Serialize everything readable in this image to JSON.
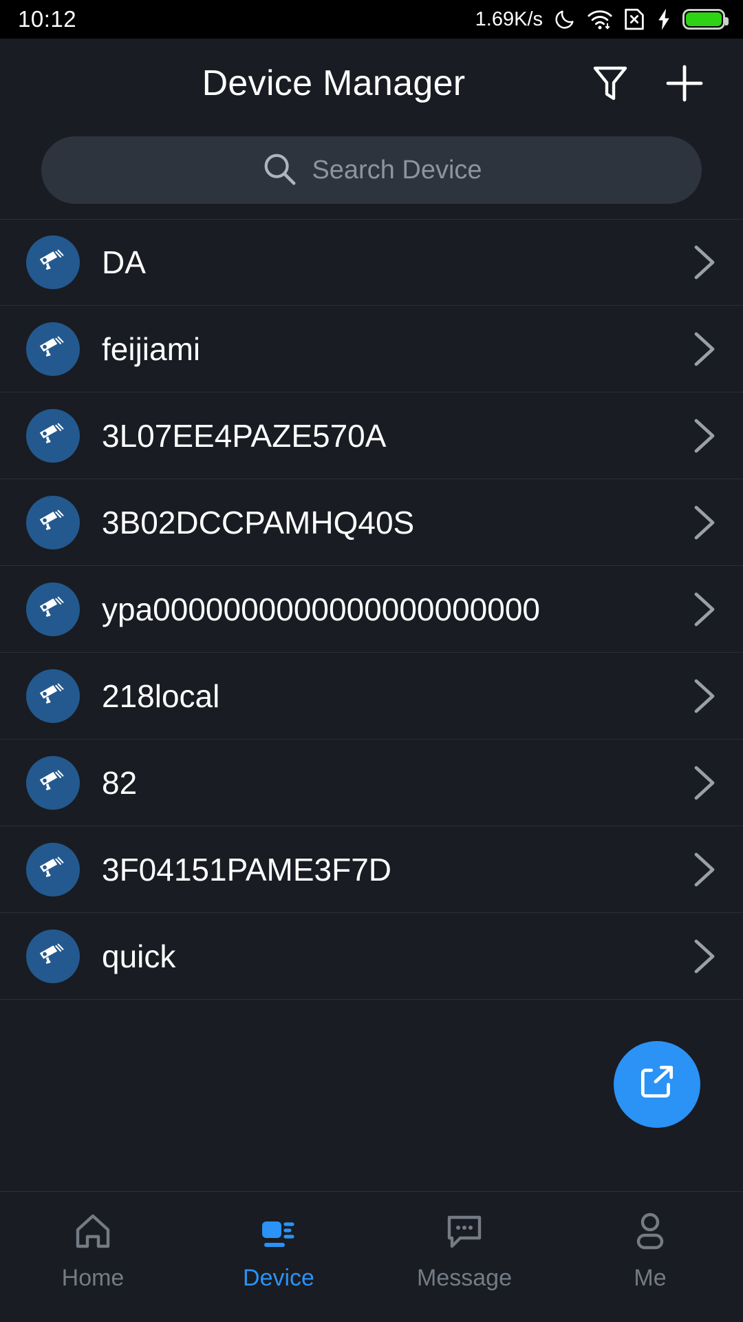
{
  "statusbar": {
    "time": "10:12",
    "network_speed": "1.69K/s",
    "icons": [
      "dnd-moon-icon",
      "wifi-icon",
      "no-sim-icon",
      "charging-bolt-icon",
      "battery-icon"
    ],
    "battery_color": "#2fd215"
  },
  "header": {
    "title": "Device Manager",
    "filter_label": "filter-icon",
    "add_label": "add-icon"
  },
  "search": {
    "placeholder": "Search Device",
    "value": ""
  },
  "devices": [
    {
      "name": "DA"
    },
    {
      "name": "feijiami"
    },
    {
      "name": "3L07EE4PAZE570A"
    },
    {
      "name": "3B02DCCPAMHQ40S"
    },
    {
      "name": "ypa0000000000000000000000"
    },
    {
      "name": "218local"
    },
    {
      "name": "82"
    },
    {
      "name": "3F04151PAME3F7D"
    },
    {
      "name": "quick"
    }
  ],
  "fab": {
    "label": "share-export-icon",
    "color": "#2b92f6"
  },
  "tabs": [
    {
      "label": "Home",
      "icon": "home-icon",
      "active": false
    },
    {
      "label": "Device",
      "icon": "camcorder-icon",
      "active": true
    },
    {
      "label": "Message",
      "icon": "message-icon",
      "active": false
    },
    {
      "label": "Me",
      "icon": "person-icon",
      "active": false
    }
  ],
  "theme": {
    "accent": "#2b92f6",
    "device_icon_bg": "#23598e",
    "background": "#191c22"
  }
}
